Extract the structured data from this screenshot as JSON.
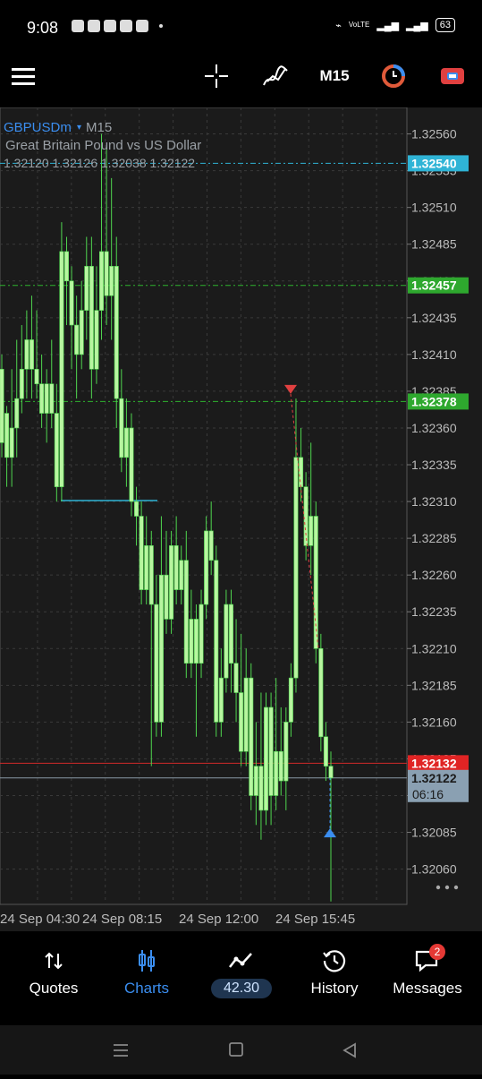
{
  "status": {
    "time": "9:08",
    "battery": "63",
    "net": "VoLTE"
  },
  "toolbar": {
    "timeframe": "M15"
  },
  "chart": {
    "symbol": "GBPUSDm",
    "timeframe": "M15",
    "description": "Great Britain Pound vs US Dollar",
    "ohlc": "1.32120 1.32126 1.32038 1.32122",
    "countdown": "06:16"
  },
  "chart_data": {
    "type": "candlestick",
    "ylim": [
      1.32036,
      1.32578
    ],
    "y_ticks": [
      "1.32560",
      "1.32535",
      "1.32510",
      "1.32485",
      "1.32460",
      "1.32435",
      "1.32410",
      "1.32385",
      "1.32360",
      "1.32335",
      "1.32310",
      "1.32285",
      "1.32260",
      "1.32235",
      "1.32210",
      "1.32185",
      "1.32160",
      "1.32135",
      "1.32110",
      "1.32085",
      "1.32060"
    ],
    "x_ticks": [
      "24 Sep 04:30",
      "24 Sep 08:15",
      "24 Sep 12:00",
      "24 Sep 15:45"
    ],
    "price_lines": [
      {
        "label": "1.32540",
        "value": 1.3254,
        "color": "#2fb4d6",
        "badge_color": "#2fb4d6"
      },
      {
        "label": "1.32457",
        "value": 1.32457,
        "color": "#2eb32e",
        "badge_color": "#2ea82e"
      },
      {
        "label": "1.32378",
        "value": 1.32378,
        "color": "#2eb32e",
        "badge_color": "#2ea82e"
      },
      {
        "label": "1.32132",
        "value": 1.32132,
        "color": "#d12b2b",
        "badge_color": "#e02424"
      },
      {
        "label": "1.32122",
        "value": 1.32122,
        "color": "#8a99a6",
        "badge_color": "#8aa0b2"
      }
    ],
    "candles": [
      [
        1.324,
        1.3235,
        1.3241,
        1.3234
      ],
      [
        1.3237,
        1.3234,
        1.32375,
        1.3232
      ],
      [
        1.3234,
        1.3236,
        1.324,
        1.3232
      ],
      [
        1.3236,
        1.3238,
        1.3242,
        1.3234
      ],
      [
        1.3238,
        1.324,
        1.3243,
        1.3237
      ],
      [
        1.324,
        1.3242,
        1.3244,
        1.3238
      ],
      [
        1.3242,
        1.324,
        1.3245,
        1.3238
      ],
      [
        1.324,
        1.3239,
        1.3244,
        1.3238
      ],
      [
        1.3239,
        1.3237,
        1.3241,
        1.3236
      ],
      [
        1.3237,
        1.3239,
        1.324,
        1.3235
      ],
      [
        1.3239,
        1.3237,
        1.3242,
        1.3236
      ],
      [
        1.3237,
        1.3232,
        1.3239,
        1.3231
      ],
      [
        1.3232,
        1.3248,
        1.325,
        1.3231
      ],
      [
        1.3248,
        1.3246,
        1.3249,
        1.3243
      ],
      [
        1.3246,
        1.3243,
        1.3247,
        1.324
      ],
      [
        1.3243,
        1.3241,
        1.3245,
        1.3238
      ],
      [
        1.3241,
        1.3244,
        1.3246,
        1.324
      ],
      [
        1.3244,
        1.3247,
        1.3249,
        1.3242
      ],
      [
        1.3247,
        1.324,
        1.3249,
        1.3238
      ],
      [
        1.324,
        1.3244,
        1.3247,
        1.3239
      ],
      [
        1.3244,
        1.3248,
        1.3256,
        1.3242
      ],
      [
        1.3248,
        1.3245,
        1.3255,
        1.3243
      ],
      [
        1.3245,
        1.3247,
        1.3253,
        1.3242
      ],
      [
        1.3247,
        1.3238,
        1.3249,
        1.3236
      ],
      [
        1.3238,
        1.3234,
        1.324,
        1.3233
      ],
      [
        1.3234,
        1.3236,
        1.3238,
        1.3232
      ],
      [
        1.3236,
        1.3231,
        1.3237,
        1.323
      ],
      [
        1.3231,
        1.323,
        1.3232,
        1.3228
      ],
      [
        1.323,
        1.3225,
        1.3231,
        1.3224
      ],
      [
        1.3225,
        1.3228,
        1.323,
        1.3224
      ],
      [
        1.3228,
        1.3224,
        1.3229,
        1.3213
      ],
      [
        1.3224,
        1.3216,
        1.3226,
        1.3215
      ],
      [
        1.3216,
        1.3226,
        1.323,
        1.3215
      ],
      [
        1.3226,
        1.3223,
        1.3229,
        1.3222
      ],
      [
        1.3223,
        1.3228,
        1.3229,
        1.3222
      ],
      [
        1.3228,
        1.3225,
        1.323,
        1.3224
      ],
      [
        1.3225,
        1.3227,
        1.3228,
        1.3224
      ],
      [
        1.3227,
        1.322,
        1.3229,
        1.3219
      ],
      [
        1.322,
        1.3223,
        1.3225,
        1.3219
      ],
      [
        1.3223,
        1.322,
        1.3224,
        1.3215
      ],
      [
        1.322,
        1.3224,
        1.3225,
        1.3219
      ],
      [
        1.3224,
        1.3229,
        1.323,
        1.3223
      ],
      [
        1.3229,
        1.3227,
        1.3231,
        1.3226
      ],
      [
        1.3227,
        1.3216,
        1.3228,
        1.3215
      ],
      [
        1.3216,
        1.3219,
        1.3221,
        1.3215
      ],
      [
        1.3219,
        1.3224,
        1.3225,
        1.3218
      ],
      [
        1.3224,
        1.322,
        1.3225,
        1.3218
      ],
      [
        1.322,
        1.3218,
        1.3223,
        1.3216
      ],
      [
        1.3218,
        1.3214,
        1.3222,
        1.3213
      ],
      [
        1.3214,
        1.3219,
        1.3221,
        1.3213
      ],
      [
        1.3219,
        1.3211,
        1.322,
        1.321
      ],
      [
        1.3211,
        1.3213,
        1.3216,
        1.3209
      ],
      [
        1.3213,
        1.321,
        1.3218,
        1.3208
      ],
      [
        1.321,
        1.3217,
        1.3218,
        1.3209
      ],
      [
        1.3217,
        1.3211,
        1.3218,
        1.3209
      ],
      [
        1.3211,
        1.3214,
        1.3219,
        1.321
      ],
      [
        1.3214,
        1.3212,
        1.3217,
        1.3211
      ],
      [
        1.3212,
        1.3216,
        1.3217,
        1.321
      ],
      [
        1.3216,
        1.3219,
        1.322,
        1.3215
      ],
      [
        1.3219,
        1.3234,
        1.3238,
        1.3218
      ],
      [
        1.3234,
        1.3232,
        1.3236,
        1.3231
      ],
      [
        1.3232,
        1.3228,
        1.3233,
        1.3227
      ],
      [
        1.3228,
        1.323,
        1.3235,
        1.3226
      ],
      [
        1.323,
        1.3221,
        1.3231,
        1.322
      ],
      [
        1.3221,
        1.3215,
        1.3222,
        1.3214
      ],
      [
        1.3215,
        1.3213,
        1.3216,
        1.3212
      ],
      [
        1.3213,
        1.32122,
        1.3214,
        1.32038
      ]
    ],
    "markers": [
      {
        "type": "sell",
        "value": 1.32385
      },
      {
        "type": "buy",
        "value": 1.32084
      }
    ]
  },
  "bottomnav": [
    {
      "label": "Quotes",
      "icon": "quotes-icon"
    },
    {
      "label": "Charts",
      "icon": "charts-icon",
      "active": true
    },
    {
      "label": "42.30",
      "icon": "trade-icon"
    },
    {
      "label": "History",
      "icon": "history-icon"
    },
    {
      "label": "Messages",
      "icon": "messages-icon",
      "badge": "2"
    }
  ],
  "colors": {
    "candle": "#b8f5a0",
    "wick": "#4fd64f",
    "grid": "#3a3a3a",
    "accent": "#3b8ef0",
    "bg": "#1b1b1b"
  }
}
